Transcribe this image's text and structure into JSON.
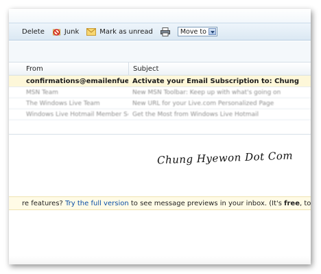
{
  "toolbar": {
    "delete": "Delete",
    "junk": "Junk",
    "mark_unread": "Mark as unread",
    "move_to": "Move to"
  },
  "columns": {
    "from": "From",
    "subject": "Subject"
  },
  "messages": [
    {
      "from": "confirmations@emailenfuego.r",
      "subject": "Activate your Email Subscription to: Chung"
    },
    {
      "from": "MSN Team",
      "subject": "New MSN Toolbar: Keep up with what's going on"
    },
    {
      "from": "The Windows Live Team",
      "subject": "New URL for your Live.com Personalized Page"
    },
    {
      "from": "Windows Live Hotmail Member Ser",
      "subject": "Get the Most from Windows Live Hotmail"
    }
  ],
  "watermark": "Chung Hyewon Dot Com",
  "banner": {
    "prefix": "re features?",
    "link": "Try the full version",
    "middle": "to see message previews in your inbox. (It's",
    "bold": "free",
    "suffix": ", too.)"
  },
  "colors": {
    "toolbar": "#dbe8f3",
    "selected_row": "#fdf7d9",
    "banner": "#fffbe6",
    "link": "#0b4fa6"
  }
}
